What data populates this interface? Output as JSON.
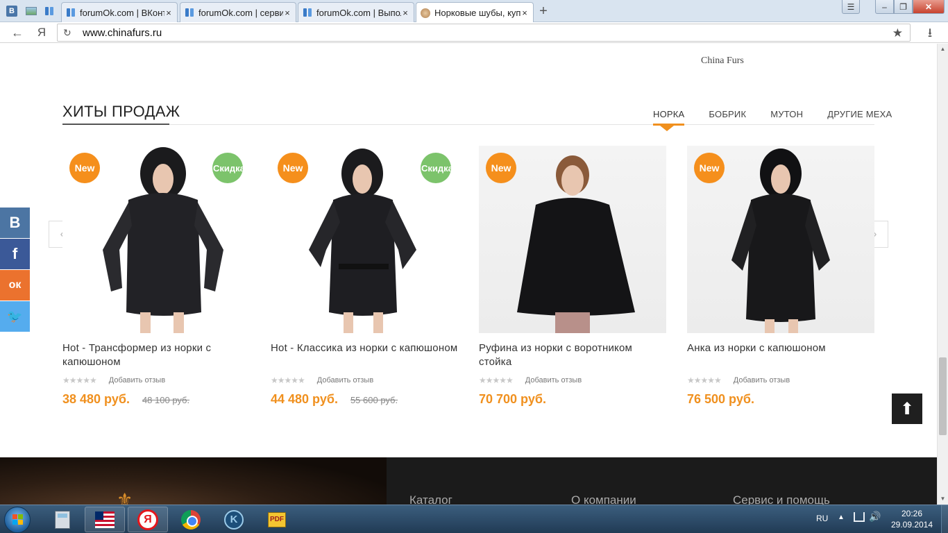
{
  "browser": {
    "pinned": [
      {
        "name": "vk-pinned-tab",
        "glyph": "В"
      },
      {
        "name": "image-pinned-tab"
      },
      {
        "name": "forumok-pinned-tab"
      }
    ],
    "tabs": [
      {
        "title": "forumOk.com | ВКонт",
        "active": false
      },
      {
        "title": "forumOk.com | серви",
        "active": false
      },
      {
        "title": "forumOk.com | Выпол",
        "active": false
      },
      {
        "title": "Норковые шубы, куп",
        "active": true
      }
    ],
    "close_glyph": "×",
    "new_tab_glyph": "+",
    "url": "www.chinafurs.ru",
    "yandex_glyph": "Я"
  },
  "page": {
    "top_brand": "China Furs",
    "section_title": "ХИТЫ ПРОДАЖ",
    "category_tabs": [
      {
        "label": "НОРКА",
        "active": true
      },
      {
        "label": "БОБРИК",
        "active": false
      },
      {
        "label": "МУТОН",
        "active": false
      },
      {
        "label": "ДРУГИЕ МЕХА",
        "active": false
      }
    ],
    "review_label": "Добавить отзыв",
    "badge_new": "New",
    "badge_sale": "Скидка",
    "products": [
      {
        "name": "Hot - Трансформер из норки с капюшоном",
        "price": "38 480 руб.",
        "old_price": "48 100 руб.",
        "sale": true,
        "rating": "★★★★★"
      },
      {
        "name": "Hot - Классика из норки с капюшоном",
        "price": "44 480 руб.",
        "old_price": "55 600 руб.",
        "sale": true,
        "rating": "★★★★★"
      },
      {
        "name": "Руфина из норки с воротником стойка",
        "price": "70 700 руб.",
        "old_price": "",
        "sale": false,
        "rating": "★★★★★"
      },
      {
        "name": "Анка из норки с капюшоном",
        "price": "76 500 руб.",
        "old_price": "",
        "sale": false,
        "rating": "★★★★★"
      }
    ],
    "prev_glyph": "‹",
    "next_glyph": "›",
    "social": [
      {
        "name": "vk-share-button",
        "glyph": "В"
      },
      {
        "name": "facebook-share-button",
        "glyph": "f"
      },
      {
        "name": "odnoklassniki-share-button",
        "glyph": "ок"
      },
      {
        "name": "twitter-share-button",
        "glyph": "🐦"
      }
    ],
    "footer": {
      "headings": [
        "Каталог",
        "О компании",
        "Сервис и помощь"
      ]
    }
  },
  "taskbar": {
    "lang": "RU",
    "time": "20:26",
    "date": "29.09.2014",
    "pdf_label": "PDF"
  },
  "colors": {
    "accent": "#f0901e",
    "badge_new": "#f58f1c",
    "badge_sale": "#7cc36b"
  }
}
